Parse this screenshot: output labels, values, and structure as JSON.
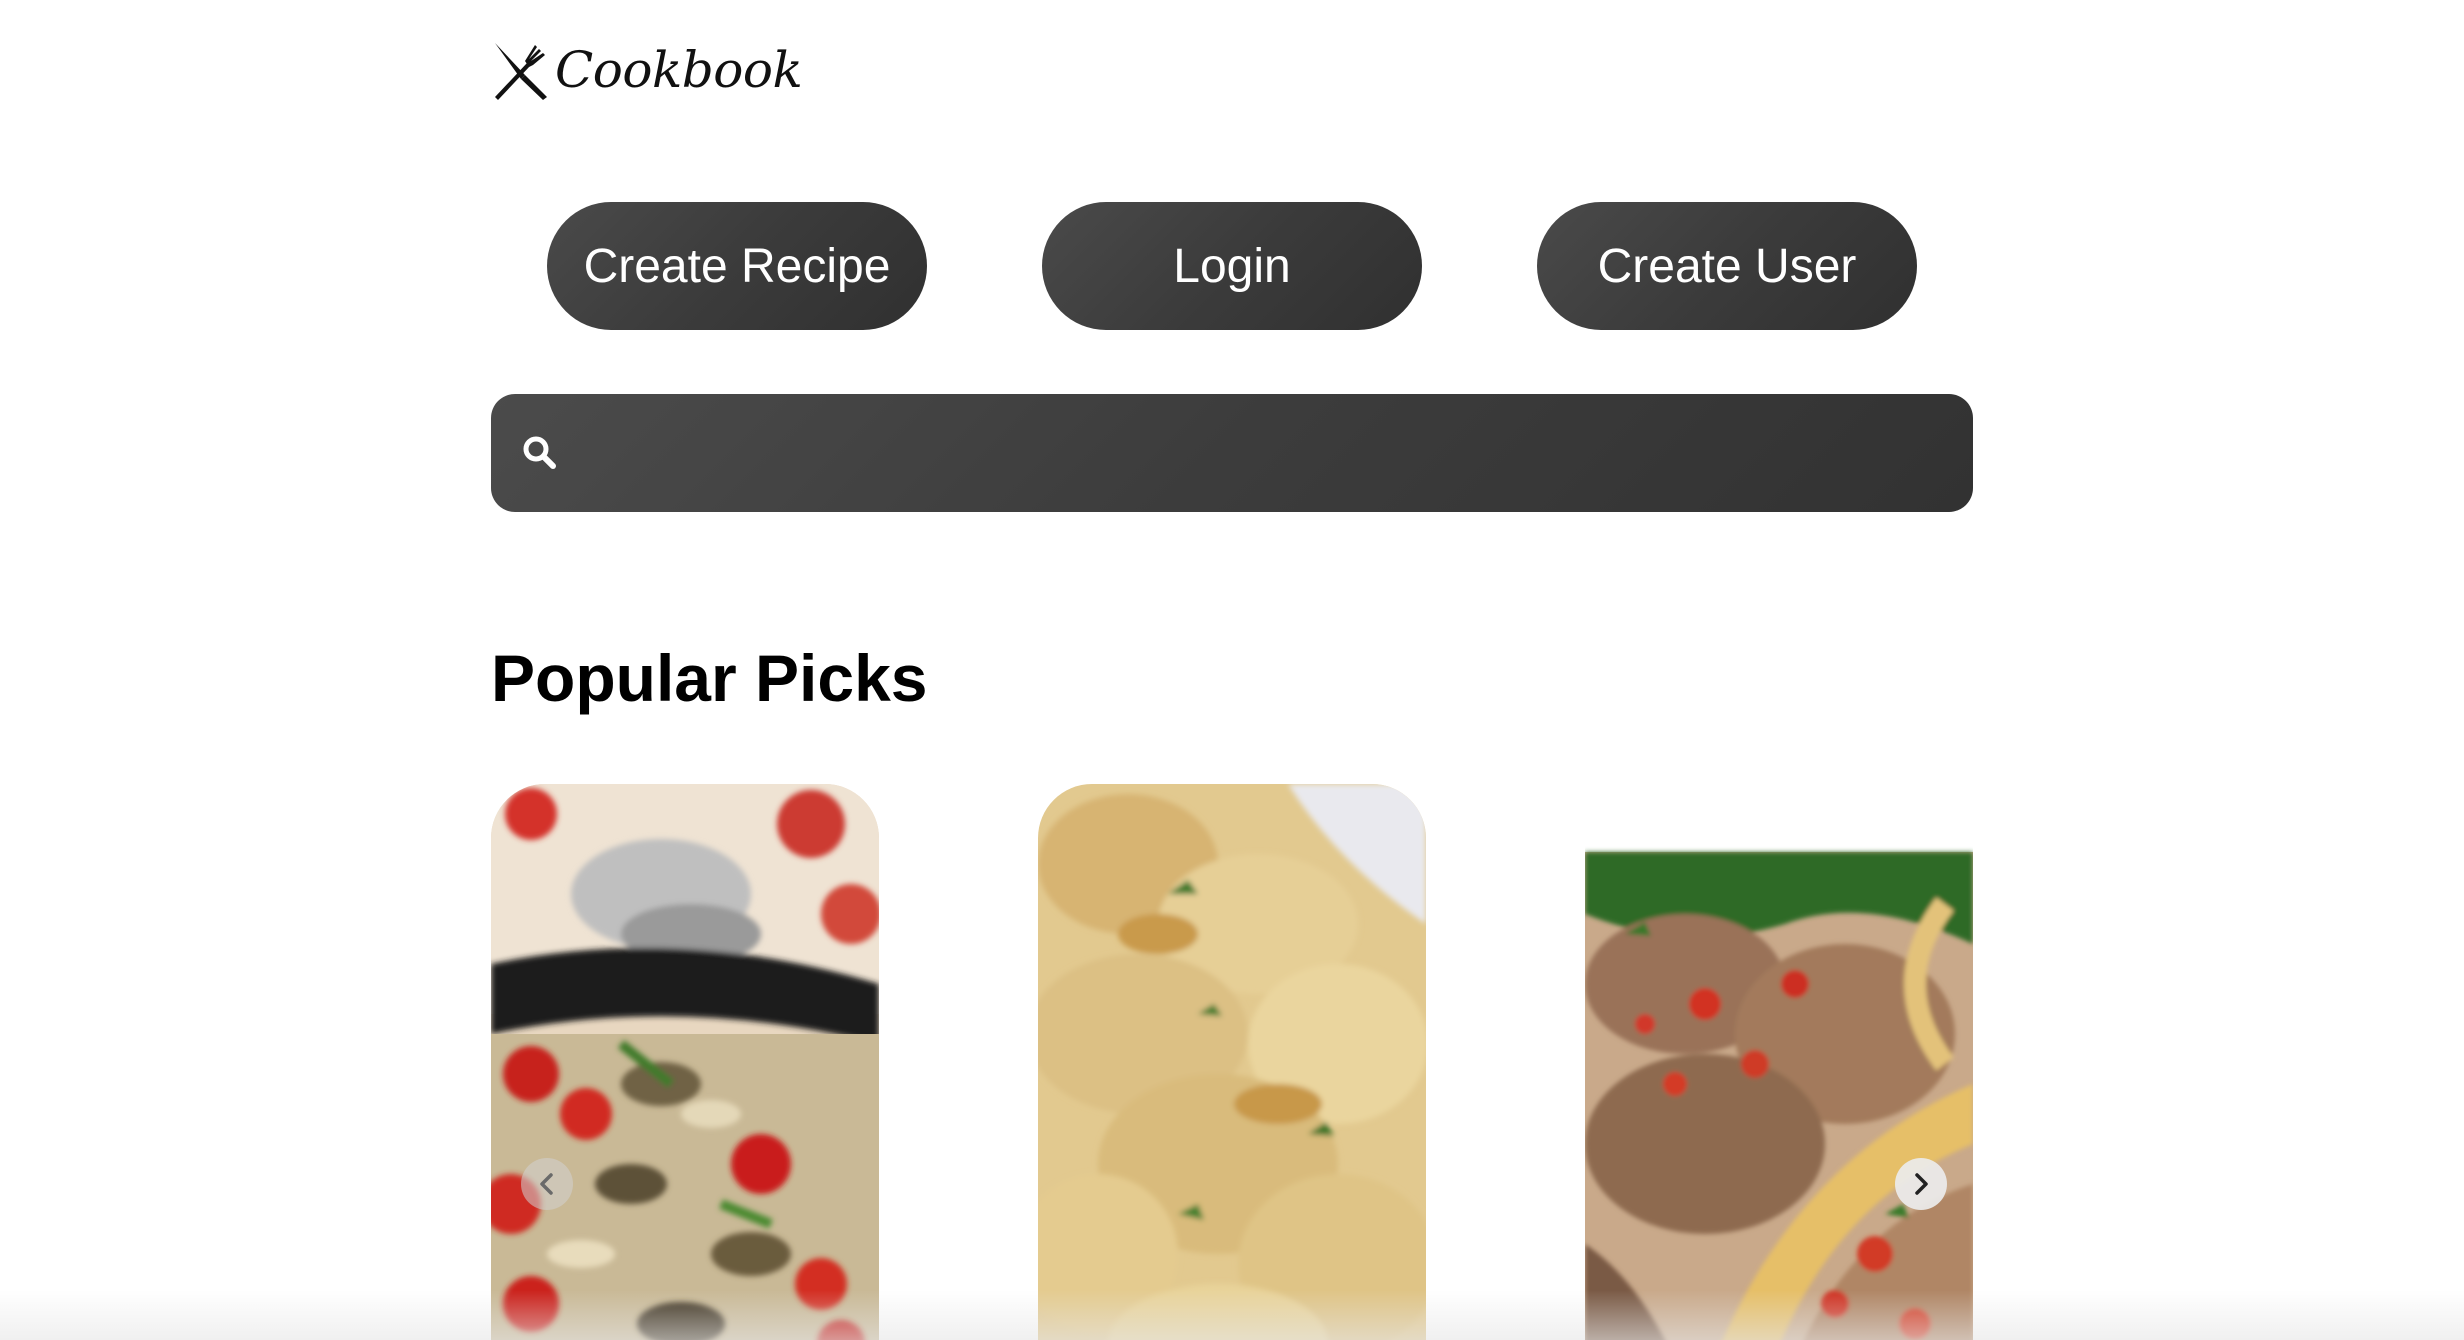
{
  "header": {
    "logo_text": "Cookbook",
    "logo_icon": "crossed-utensils-icon"
  },
  "nav": {
    "create_recipe_label": "Create Recipe",
    "login_label": "Login",
    "create_user_label": "Create User"
  },
  "search": {
    "icon": "search-icon",
    "value": "",
    "placeholder": ""
  },
  "popular": {
    "title": "Popular Picks",
    "cards": [
      {
        "image": "pasta-with-tomatoes-and-mushrooms"
      },
      {
        "image": "fried-breaded-shrimp"
      },
      {
        "image": "pulled-pork-tacos"
      }
    ],
    "prev_icon": "chevron-left-icon",
    "next_icon": "chevron-right-icon"
  },
  "colors": {
    "button_bg": "#3b3b3b",
    "button_text": "#ffffff",
    "page_bg": "#ffffff",
    "heading_text": "#000000"
  }
}
